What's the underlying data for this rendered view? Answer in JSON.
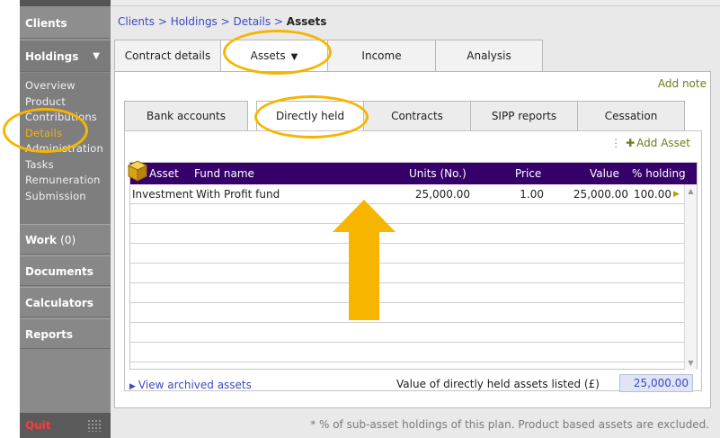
{
  "sidebar": {
    "clients": "Clients",
    "holdings": "Holdings",
    "holdings_arrow": "▼",
    "subitems": [
      "Overview",
      "Product",
      "Contributions",
      "Details",
      "Administration",
      "Tasks",
      "Remuneration",
      "Submission"
    ],
    "active_subitem": "Details",
    "work": "Work",
    "work_count": "(0)",
    "documents": "Documents",
    "calculators": "Calculators",
    "reports": "Reports",
    "quit": "Quit"
  },
  "breadcrumb": {
    "part1": "Clients",
    "sep": " > ",
    "part2": "Holdings",
    "part3": "Details",
    "current": "Assets"
  },
  "tabs_main": [
    {
      "label": "Contract details"
    },
    {
      "label": "Assets",
      "dropdown": "▼",
      "selected": true
    },
    {
      "label": "Income"
    },
    {
      "label": "Analysis"
    }
  ],
  "add_note": "Add note",
  "tabs_sub": [
    {
      "label": "Bank accounts"
    },
    {
      "label": "Directly held",
      "selected": true
    },
    {
      "label": "Contracts"
    },
    {
      "label": "SIPP reports"
    },
    {
      "label": "Cessation"
    }
  ],
  "add_asset": "Add Asset",
  "grid": {
    "columns": [
      "Asset",
      "Fund name",
      "Units (No.)",
      "Price",
      "Value",
      "% holding"
    ],
    "rows": [
      {
        "asset": "Investment",
        "fund": "With Profit fund",
        "units": "25,000.00",
        "price": "1.00",
        "value": "25,000.00",
        "holding": "100.00"
      }
    ]
  },
  "view_archived": "View archived assets",
  "total_label": "Value of directly held assets listed (£)",
  "total_value": "25,000.00",
  "footnote": "* % of sub-asset holdings of this plan. Product based assets are excluded.",
  "colors": {
    "header_purple": "#36006b",
    "link_blue": "#3a4bc4",
    "olive": "#6d7d1c",
    "highlight": "#f7b500",
    "quit_red": "#ff3a3a"
  }
}
